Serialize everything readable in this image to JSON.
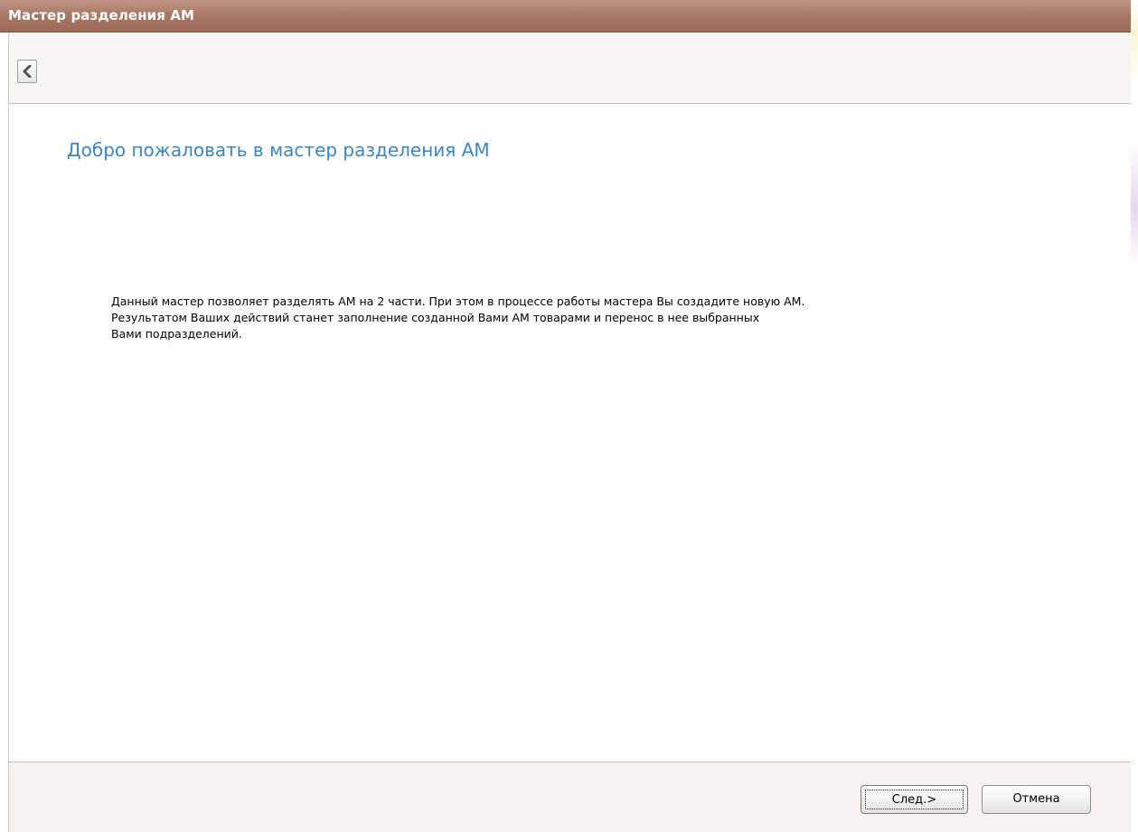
{
  "window": {
    "title": "Мастер разделения АМ"
  },
  "toolbar": {
    "back_icon": "chevron-left-icon"
  },
  "main": {
    "heading": "Добро пожаловать в мастер разделения АМ",
    "description_lines": [
      "Данный мастер позволяет разделять АМ на 2 части. При этом в процессе работы мастера Вы создадите новую АМ.",
      "Результатом Ваших действий станет заполнение созданной Вами АМ товарами и перенос в нее выбранных",
      "Вами подразделений."
    ]
  },
  "footer": {
    "next_label": "След.>",
    "cancel_label": "Отмена"
  },
  "colors": {
    "titlebar": "#a87966",
    "heading": "#3a87c2"
  }
}
